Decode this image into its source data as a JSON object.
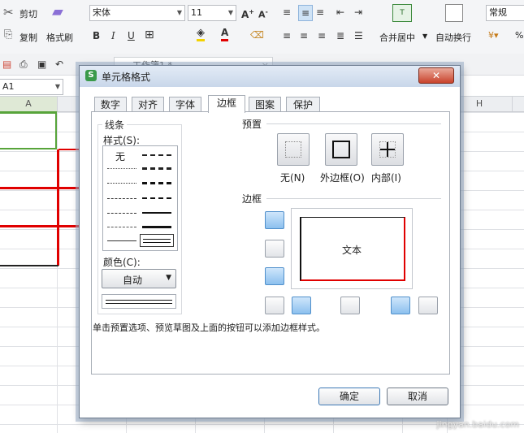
{
  "ribbon": {
    "cut": "剪切",
    "copy": "复制",
    "format_painter": "格式刷",
    "font_name": "宋体",
    "font_size": "11",
    "bold": "B",
    "italic": "I",
    "underline": "U",
    "merge_center": "合并居中",
    "wrap_text": "自动换行",
    "number_format": "常规"
  },
  "sheet": {
    "tab_name": "工作簿1 *",
    "name_box": "A1",
    "col_a": "A",
    "col_h": "H"
  },
  "dialog": {
    "title": "单元格格式",
    "close": "✕",
    "tabs": [
      "数字",
      "对齐",
      "字体",
      "边框",
      "图案",
      "保护"
    ],
    "line_group": "线条",
    "style_label": "样式(S):",
    "style_none": "无",
    "color_label": "颜色(C):",
    "color_value": "自动",
    "preset_label": "预置",
    "preset_none": "无(N)",
    "preset_outline": "外边框(O)",
    "preset_inside": "内部(I)",
    "border_label": "边框",
    "preview_text": "文本",
    "hint": "单击预置选项、预览草图及上面的按钮可以添加边框样式。",
    "ok": "确定",
    "cancel": "取消"
  },
  "watermark": "jingyan.baidu.com",
  "colors": {
    "accent_red": "#e00000",
    "select_green": "#57a43a"
  }
}
